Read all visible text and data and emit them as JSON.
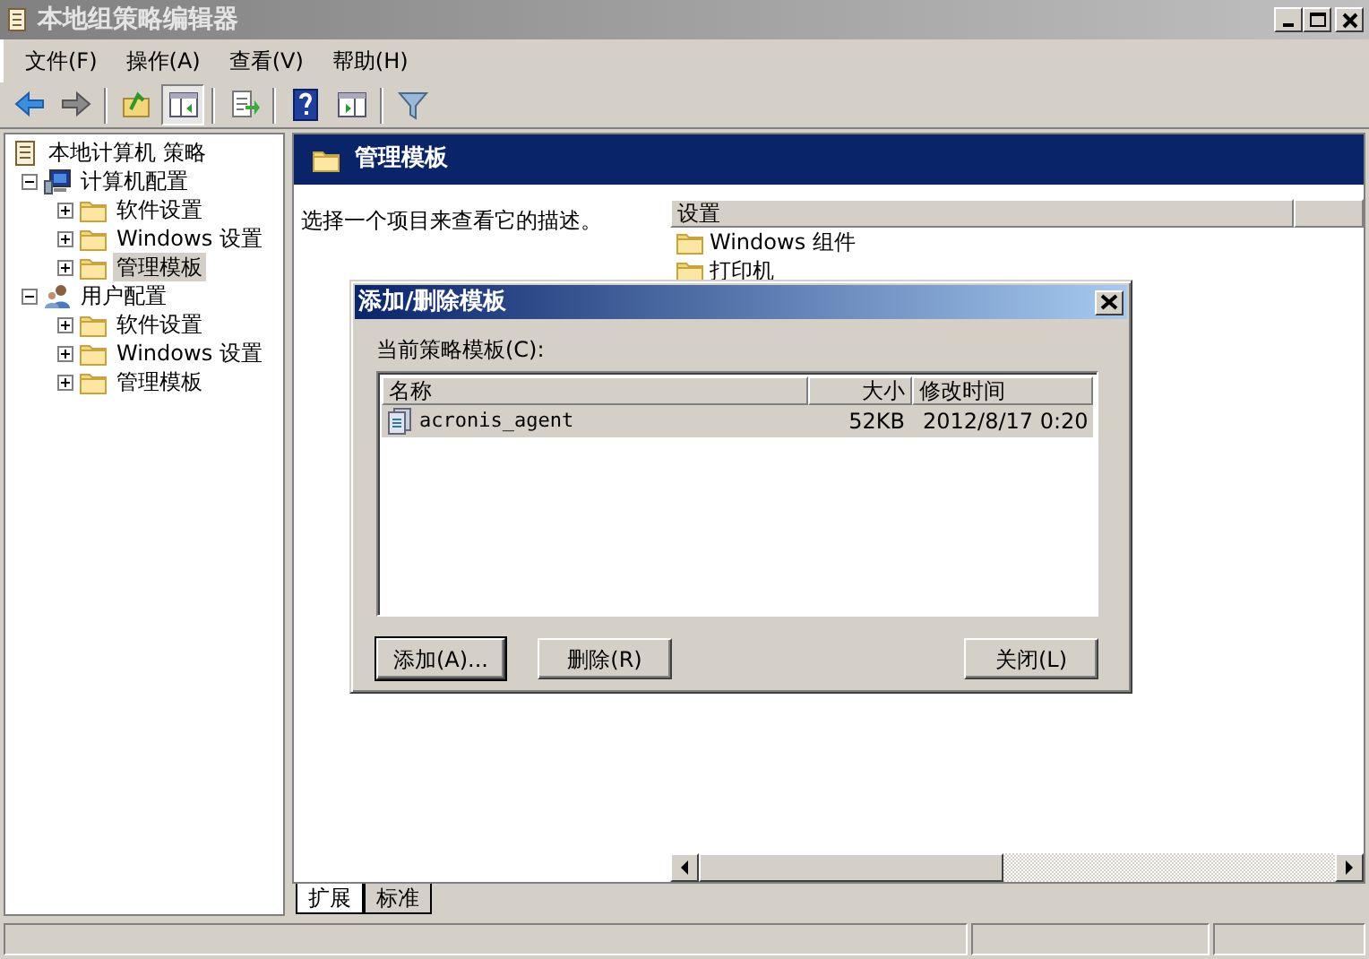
{
  "window": {
    "title": "本地组策略编辑器"
  },
  "menu": [
    "文件(F)",
    "操作(A)",
    "查看(V)",
    "帮助(H)"
  ],
  "toolbar": [
    {
      "kind": "back",
      "pressed": false
    },
    {
      "kind": "forward",
      "pressed": false
    },
    {
      "kind": "separator"
    },
    {
      "kind": "up",
      "pressed": false
    },
    {
      "kind": "tree",
      "pressed": true
    },
    {
      "kind": "separator"
    },
    {
      "kind": "export",
      "pressed": false
    },
    {
      "kind": "separator"
    },
    {
      "kind": "help",
      "pressed": false
    },
    {
      "kind": "panel",
      "pressed": false
    },
    {
      "kind": "separator"
    },
    {
      "kind": "filter",
      "pressed": false
    }
  ],
  "tree": {
    "label": "本地计算机 策略",
    "kind": "policy",
    "children": [
      {
        "label": "计算机配置",
        "kind": "computer",
        "expanded": true,
        "selected": false,
        "children": [
          {
            "label": "软件设置",
            "kind": "folder",
            "expanded": false,
            "selected": false
          },
          {
            "label": "Windows 设置",
            "kind": "folder",
            "expanded": false,
            "selected": false
          },
          {
            "label": "管理模板",
            "kind": "folder",
            "expanded": false,
            "selected": true
          }
        ]
      },
      {
        "label": "用户配置",
        "kind": "user",
        "expanded": true,
        "selected": false,
        "children": [
          {
            "label": "软件设置",
            "kind": "folder",
            "expanded": false,
            "selected": false
          },
          {
            "label": "Windows 设置",
            "kind": "folder",
            "expanded": false,
            "selected": false
          },
          {
            "label": "管理模板",
            "kind": "folder",
            "expanded": false,
            "selected": false
          }
        ]
      }
    ]
  },
  "details": {
    "title": "管理模板",
    "description": "选择一个项目来查看它的描述。",
    "columns": [
      "设置"
    ],
    "items": [
      "Windows 组件",
      "打印机"
    ]
  },
  "tabs": [
    {
      "label": "扩展",
      "selected": true
    },
    {
      "label": "标准",
      "selected": false
    }
  ],
  "dialog": {
    "title": "添加/删除模板",
    "list_label": "当前策略模板(C):",
    "columns": [
      "名称",
      "大小",
      "修改时间"
    ],
    "rows": [
      {
        "name": "acronis_agent",
        "size": "52KB",
        "modified": "2012/8/17 0:20",
        "selected": true
      }
    ],
    "buttons": [
      {
        "label": "添加(A)...",
        "default": true
      },
      {
        "label": "删除(R)",
        "default": false
      },
      {
        "label": "关闭(L)",
        "default": false
      }
    ]
  }
}
